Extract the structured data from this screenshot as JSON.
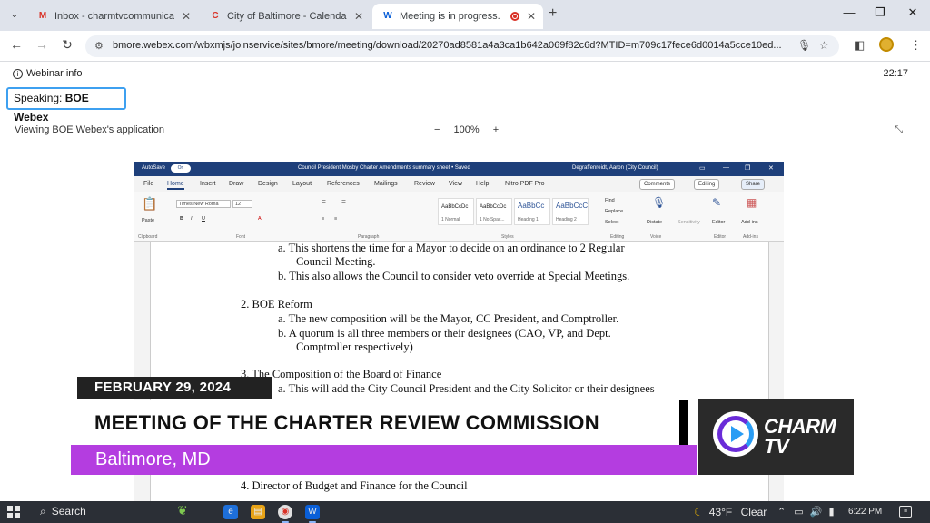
{
  "browser": {
    "tabs": [
      {
        "label": "Inbox - charmtvcommunicatio",
        "favicon": "M",
        "favicon_color": "#d93025"
      },
      {
        "label": "City of Baltimore - Calendar",
        "favicon": "C",
        "favicon_color": "#d93025"
      },
      {
        "label": "Meeting is in progress...",
        "favicon": "W",
        "favicon_color": "#0a5fd8"
      }
    ],
    "url": "bmore.webex.com/wbxmjs/joinservice/sites/bmore/meeting/download/20270ad8581a4a3ca1b642a069f82c6d?MTID=m709c17fece6d0014a5cce10ed..."
  },
  "webex": {
    "webinar_info": "Webinar info",
    "timer": "22:17",
    "speaking_prefix": "Speaking: ",
    "speaking_name": "BOE Webex",
    "viewing": "Viewing BOE Webex's application",
    "zoom_minus": "−",
    "zoom_level": "100%",
    "zoom_plus": "+"
  },
  "word": {
    "autosave": "AutoSave",
    "autosave_state": "On",
    "doc_title": "Council President Mosby Charter Amendments summary sheet • Saved",
    "user": "Degraffenreidt, Aaron (City Council)",
    "tabs": [
      "File",
      "Home",
      "Insert",
      "Draw",
      "Design",
      "Layout",
      "References",
      "Mailings",
      "Review",
      "View",
      "Help",
      "Nitro PDF Pro"
    ],
    "comments": "Comments",
    "editing": "Editing",
    "share": "Share",
    "ribbon": {
      "paste": "Paste",
      "clipboard": "Clipboard",
      "font_name": "Times New Roma",
      "font_size": "12",
      "font_group": "Font",
      "paragraph_group": "Paragraph",
      "styles": [
        {
          "preview": "AaBbCcDc",
          "name": "1 Normal"
        },
        {
          "preview": "AaBbCcDc",
          "name": "1 No Spac..."
        },
        {
          "preview": "AaBbCc",
          "name": "Heading 1"
        },
        {
          "preview": "AaBbCcC",
          "name": "Heading 2"
        }
      ],
      "styles_group": "Styles",
      "find": "Find",
      "replace": "Replace",
      "select": "Select",
      "editing_group": "Editing",
      "dictate": "Dictate",
      "voice_group": "Voice",
      "sensitivity": "Sensitivity",
      "editor": "Editor",
      "editor_group": "Editor",
      "addins": "Add-ins",
      "addins_group": "Add-ins"
    },
    "document": [
      {
        "text": "a.   This shortens the time for a Mayor to decide on an ordinance to 2 Regular"
      },
      {
        "text": "Council Meeting."
      },
      {
        "text": "b.   This also allows the Council to consider veto override at Special Meetings."
      },
      {
        "text": "2.   BOE Reform"
      },
      {
        "text": "a.   The new composition will be the Mayor, CC President, and Comptroller."
      },
      {
        "text": "b.   A quorum is all three members or their designees (CAO, VP, and Dept."
      },
      {
        "text": "Comptroller respectively)"
      },
      {
        "text": "3.   The Composition of the Board of Finance"
      },
      {
        "text": "a.   This will add the City Council President and the City Solicitor or their designees"
      }
    ],
    "bottom_line": "4.   Director of Budget and Finance for the Council"
  },
  "overlay": {
    "date": "FEBRUARY 29, 2024",
    "title": "MEETING OF THE CHARTER REVIEW COMMISSION",
    "location": "Baltimore, MD",
    "logo_line1": "CHARM",
    "logo_line2": "TV"
  },
  "taskbar": {
    "search": "Search",
    "temperature": "43°F",
    "weather": "Clear",
    "time": "6:22 PM"
  },
  "colors": {
    "accent_purple": "#b43de0",
    "speaking_border": "#3ea0f0",
    "word_blue": "#1e3f7a"
  }
}
